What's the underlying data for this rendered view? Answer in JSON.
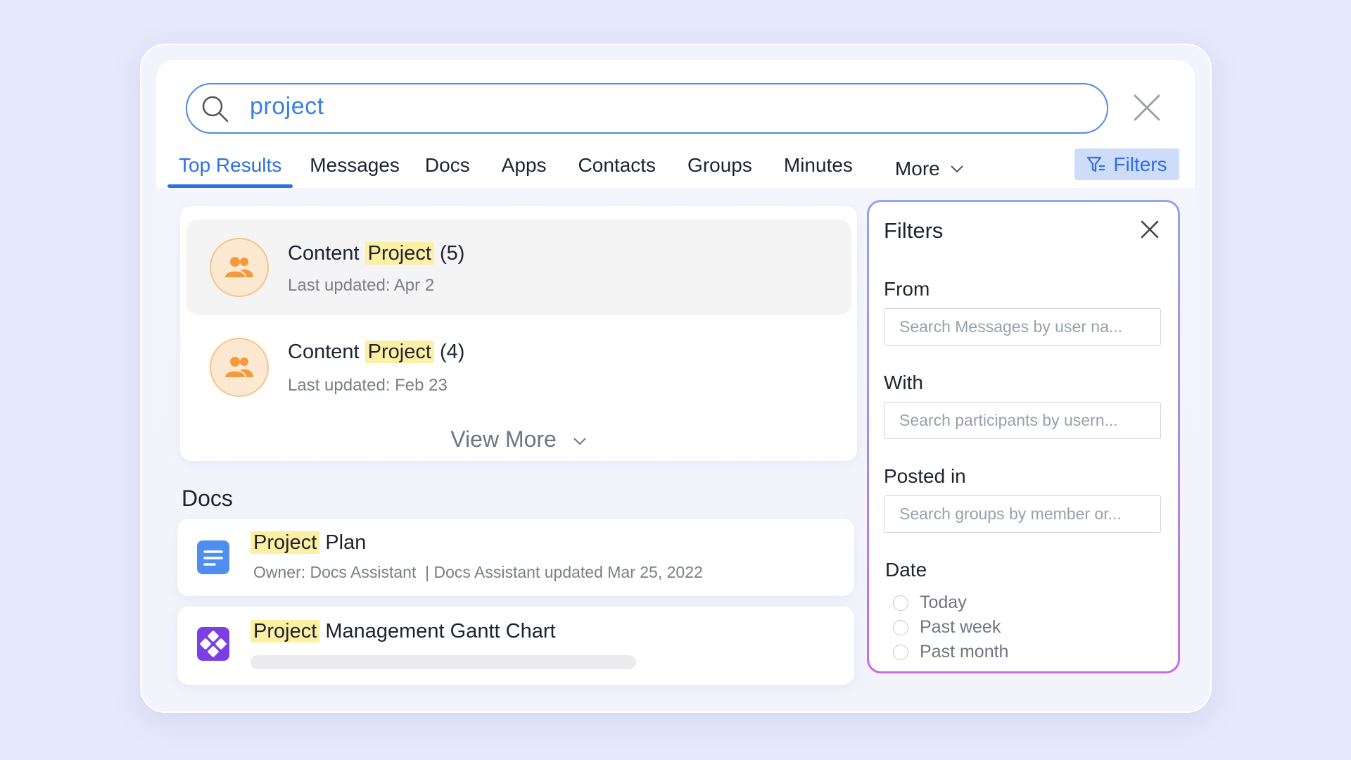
{
  "search": {
    "value": "project"
  },
  "tabs": [
    {
      "label": "Top Results",
      "active": true
    },
    {
      "label": "Messages"
    },
    {
      "label": "Docs"
    },
    {
      "label": "Apps"
    },
    {
      "label": "Contacts"
    },
    {
      "label": "Groups"
    },
    {
      "label": "Minutes"
    },
    {
      "label": "More"
    }
  ],
  "filters_button": {
    "label": "Filters"
  },
  "results": [
    {
      "title_prefix": "Content",
      "title_highlight": "Project",
      "title_suffix": "(5)",
      "subtitle": "Last updated: Apr 2",
      "icon": "group-icon"
    },
    {
      "title_prefix": "Content",
      "title_highlight": "Project",
      "title_suffix": "(4)",
      "subtitle": "Last updated: Feb 23",
      "icon": "group-icon"
    }
  ],
  "view_more": "View More",
  "docs": {
    "section_title": "Docs",
    "items": [
      {
        "title_highlight": "Project",
        "title_rest": "Plan",
        "meta": "Owner: Docs Assistant  | Docs Assistant updated Mar 25, 2022",
        "icon": "doc-icon"
      },
      {
        "title_highlight": "Project",
        "title_rest": "Management Gantt Chart",
        "meta": "",
        "icon": "app-icon"
      }
    ]
  },
  "filters_panel": {
    "title": "Filters",
    "from": {
      "label": "From",
      "placeholder": "Search Messages by user na..."
    },
    "with": {
      "label": "With",
      "placeholder": "Search participants by usern..."
    },
    "posted_in": {
      "label": "Posted in",
      "placeholder": "Search groups by member or..."
    },
    "date": {
      "label": "Date",
      "options": [
        "Today",
        "Past week",
        "Past month"
      ]
    }
  },
  "colors": {
    "accent": "#2f6fe0",
    "highlight": "#fdf0a2",
    "avatar_bg": "#fde9d2",
    "avatar_icon": "#f59a3c",
    "doc_icon": "#4f8ef0",
    "app_icon": "#7b3fe4"
  }
}
